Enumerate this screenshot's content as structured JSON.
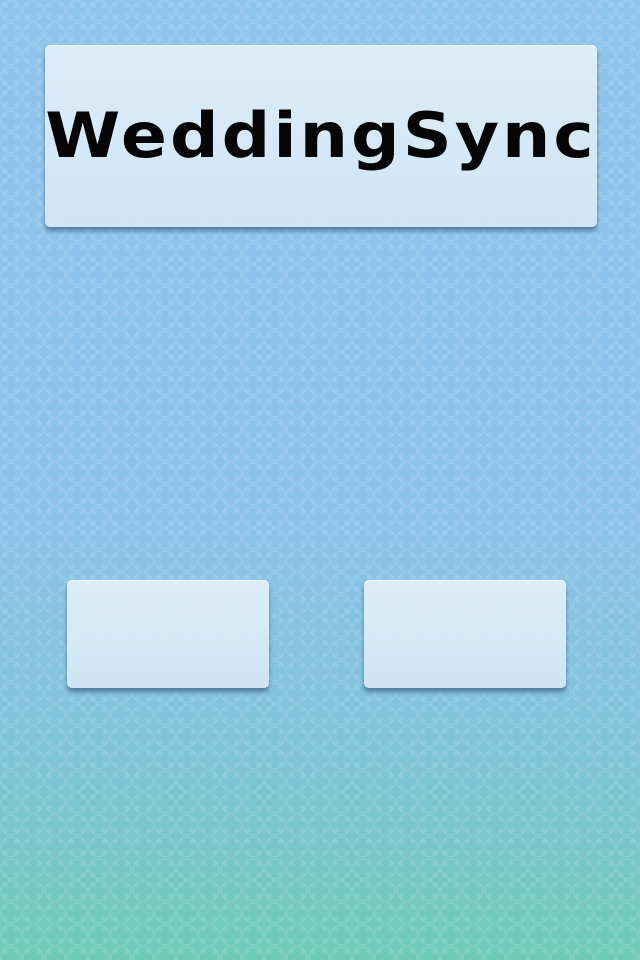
{
  "app": {
    "title": "WeddingSync"
  },
  "buttons": {
    "left_label": "",
    "right_label": ""
  },
  "colors": {
    "background_top": "#8fc4ec",
    "background_bottom": "#6fcab7",
    "panel": "#dbeaf7",
    "title_text": "#050505"
  }
}
